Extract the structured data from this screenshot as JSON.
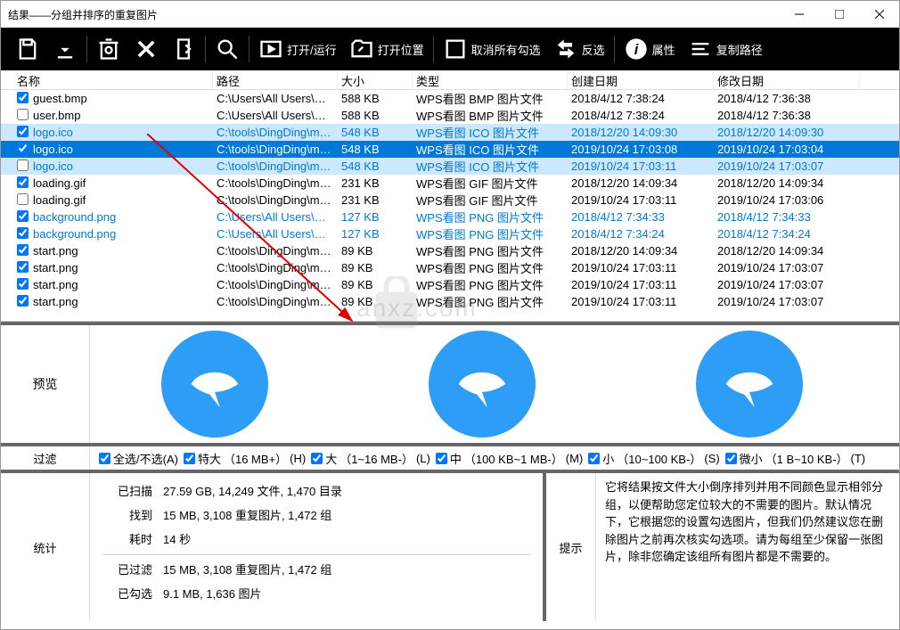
{
  "window": {
    "title": "结果——分组并排序的重复图片"
  },
  "toolbar": {
    "open_run": "打开/运行",
    "open_location": "打开位置",
    "uncheck_all": "取消所有勾选",
    "invert": "反选",
    "properties": "属性",
    "copy_path": "复制路径"
  },
  "columns": {
    "name": "名称",
    "path": "路径",
    "size": "大小",
    "type": "类型",
    "cdate": "创建日期",
    "mdate": "修改日期"
  },
  "rows": [
    {
      "chk": true,
      "cls": "norm",
      "name": "guest.bmp",
      "path": "C:\\Users\\All Users\\Micr...",
      "size": "588 KB",
      "type": "WPS看图 BMP 图片文件",
      "cdate": "2018/4/12 7:38:24",
      "mdate": "2018/4/12 7:36:38"
    },
    {
      "chk": false,
      "cls": "norm",
      "name": "user.bmp",
      "path": "C:\\Users\\All Users\\Micr...",
      "size": "588 KB",
      "type": "WPS看图 BMP 图片文件",
      "cdate": "2018/4/12 7:38:24",
      "mdate": "2018/4/12 7:36:38"
    },
    {
      "chk": true,
      "cls": "selblue",
      "name": "logo.ico",
      "path": "C:\\tools\\DingDing\\mai...",
      "size": "548 KB",
      "type": "WPS看图 ICO 图片文件",
      "cdate": "2018/12/20 14:09:30",
      "mdate": "2018/12/20 14:09:30"
    },
    {
      "chk": true,
      "cls": "sel",
      "name": "logo.ico",
      "path": "C:\\tools\\DingDing\\mai...",
      "size": "548 KB",
      "type": "WPS看图 ICO 图片文件",
      "cdate": "2019/10/24 17:03:08",
      "mdate": "2019/10/24 17:03:04"
    },
    {
      "chk": false,
      "cls": "selblue",
      "name": "logo.ico",
      "path": "C:\\tools\\DingDing\\mai...",
      "size": "548 KB",
      "type": "WPS看图 ICO 图片文件",
      "cdate": "2019/10/24 17:03:11",
      "mdate": "2019/10/24 17:03:07"
    },
    {
      "chk": true,
      "cls": "norm",
      "name": "loading.gif",
      "path": "C:\\tools\\DingDing\\mai...",
      "size": "231 KB",
      "type": "WPS看图 GIF 图片文件",
      "cdate": "2018/12/20 14:09:34",
      "mdate": "2018/12/20 14:09:34"
    },
    {
      "chk": false,
      "cls": "norm",
      "name": "loading.gif",
      "path": "C:\\tools\\DingDing\\mai...",
      "size": "231 KB",
      "type": "WPS看图 GIF 图片文件",
      "cdate": "2019/10/24 17:03:11",
      "mdate": "2019/10/24 17:03:06"
    },
    {
      "chk": true,
      "cls": "blue",
      "name": "background.png",
      "path": "C:\\Users\\All Users\\Micr...",
      "size": "127 KB",
      "type": "WPS看图 PNG 图片文件",
      "cdate": "2018/4/12 7:34:33",
      "mdate": "2018/4/12 7:34:33"
    },
    {
      "chk": true,
      "cls": "blue",
      "name": "background.png",
      "path": "C:\\Users\\All Users\\Micr...",
      "size": "127 KB",
      "type": "WPS看图 PNG 图片文件",
      "cdate": "2018/4/12 7:34:24",
      "mdate": "2018/4/12 7:34:24"
    },
    {
      "chk": true,
      "cls": "norm",
      "name": "start.png",
      "path": "C:\\tools\\DingDing\\mai...",
      "size": "89 KB",
      "type": "WPS看图 PNG 图片文件",
      "cdate": "2018/12/20 14:09:34",
      "mdate": "2018/12/20 14:09:34"
    },
    {
      "chk": true,
      "cls": "norm",
      "name": "start.png",
      "path": "C:\\tools\\DingDing\\mai...",
      "size": "89 KB",
      "type": "WPS看图 PNG 图片文件",
      "cdate": "2019/10/24 17:03:11",
      "mdate": "2019/10/24 17:03:07"
    },
    {
      "chk": true,
      "cls": "norm",
      "name": "start.png",
      "path": "C:\\tools\\DingDing\\mai...",
      "size": "89 KB",
      "type": "WPS看图 PNG 图片文件",
      "cdate": "2019/10/24 17:03:11",
      "mdate": "2019/10/24 17:03:07"
    },
    {
      "chk": true,
      "cls": "norm",
      "name": "start.png",
      "path": "C:\\tools\\DingDing\\mai...",
      "size": "89 KB",
      "type": "WPS看图 PNG 图片文件",
      "cdate": "2019/10/24 17:03:11",
      "mdate": "2019/10/24 17:03:07"
    }
  ],
  "preview": {
    "label": "预览"
  },
  "filter": {
    "label": "过滤",
    "all": "全选/不选(A)",
    "xl": "特大",
    "xl_hint": "（16 MB+）",
    "xl_key": "(H)",
    "l": "大",
    "l_hint": "（1~16 MB-）",
    "l_key": "(L)",
    "m": "中",
    "m_hint": "（100 KB~1 MB-）",
    "m_key": "(M)",
    "s": "小",
    "s_hint": "（10~100 KB-）",
    "s_key": "(S)",
    "t": "微小",
    "t_hint": "（1 B~10 KB-）",
    "t_key": "(T)"
  },
  "stats": {
    "label": "统计",
    "scanned_k": "已扫描",
    "scanned_v": "27.59 GB, 14,249 文件, 1,470 目录",
    "found_k": "找到",
    "found_v": "15 MB, 3,108 重复图片, 1,472 组",
    "time_k": "耗时",
    "time_v": "14 秒",
    "filtered_k": "已过滤",
    "filtered_v": "15 MB, 3,108 重复图片, 1,472 组",
    "checked_k": "已勾选",
    "checked_v": "9.1 MB, 1,636 图片"
  },
  "hint": {
    "label": "提示",
    "text": "它将结果按文件大小倒序排列并用不同颜色显示相邻分组，以便帮助您定位较大的不需要的图片。默认情况下，它根据您的设置勾选图片，但我们仍然建议您在删除图片之前再次核实勾选项。请为每组至少保留一张图片，除非您确定该组所有图片都是不需要的。"
  },
  "watermark": "anxz.com"
}
